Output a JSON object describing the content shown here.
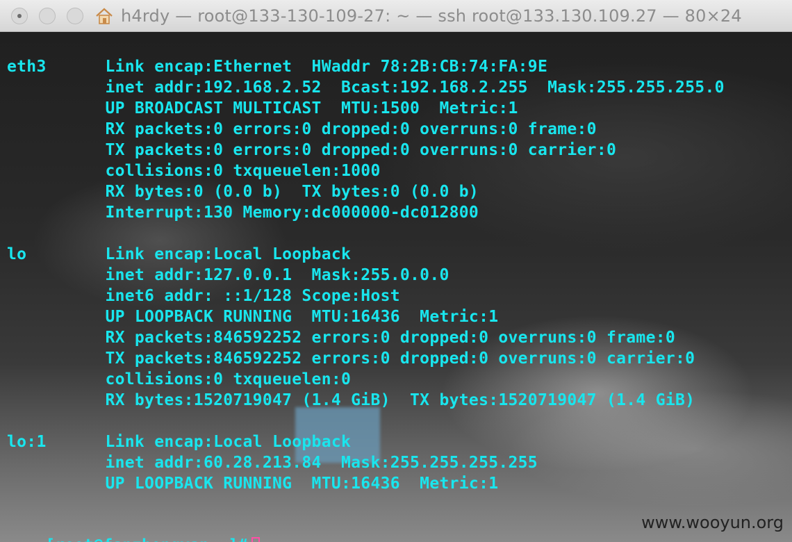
{
  "window": {
    "title": "h4rdy — root@133-130-109-27: ~ — ssh root@133.130.109.27 — 80×24",
    "title_icon": "home-icon",
    "buttons": [
      "close",
      "minimize",
      "maximize"
    ]
  },
  "colors": {
    "terminal_text": "#19e6ee",
    "cursor": "#ff4fa5",
    "titlebar": "#e3e3e3"
  },
  "terminal": {
    "lines": [
      "eth3      Link encap:Ethernet  HWaddr 78:2B:CB:74:FA:9E",
      "          inet addr:192.168.2.52  Bcast:192.168.2.255  Mask:255.255.255.0",
      "          UP BROADCAST MULTICAST  MTU:1500  Metric:1",
      "          RX packets:0 errors:0 dropped:0 overruns:0 frame:0",
      "          TX packets:0 errors:0 dropped:0 overruns:0 carrier:0",
      "          collisions:0 txqueuelen:1000",
      "          RX bytes:0 (0.0 b)  TX bytes:0 (0.0 b)",
      "          Interrupt:130 Memory:dc000000-dc012800",
      "",
      "lo        Link encap:Local Loopback",
      "          inet addr:127.0.0.1  Mask:255.0.0.0",
      "          inet6 addr: ::1/128 Scope:Host",
      "          UP LOOPBACK RUNNING  MTU:16436  Metric:1",
      "          RX packets:846592252 errors:0 dropped:0 overruns:0 frame:0",
      "          TX packets:846592252 errors:0 dropped:0 overruns:0 carrier:0",
      "          collisions:0 txqueuelen:0",
      "          RX bytes:1520719047 (1.4 GiB)  TX bytes:1520719047 (1.4 GiB)",
      "",
      "lo:1      Link encap:Local Loopback",
      "          inet addr:60.28.213.84  Mask:255.255.255.255",
      "          UP LOOPBACK RUNNING  MTU:16436  Metric:1"
    ],
    "prompt": "[root@fanzhongyan ~]#"
  },
  "watermark": "www.wooyun.org"
}
